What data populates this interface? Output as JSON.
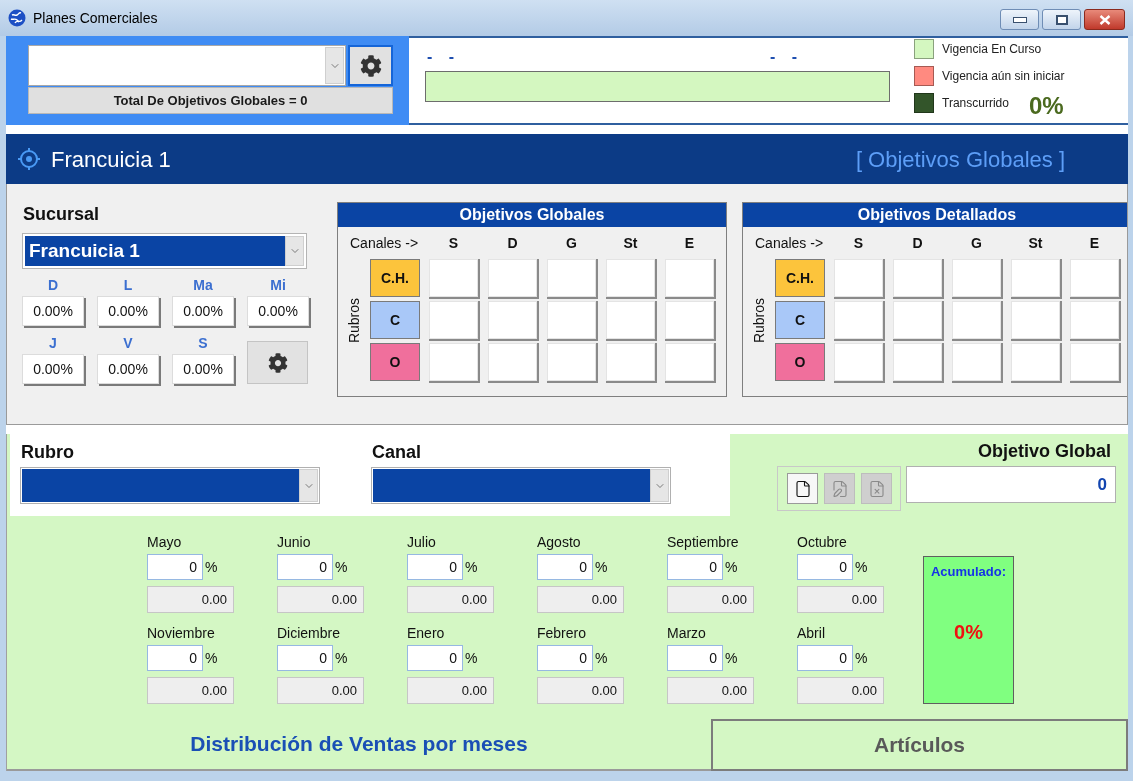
{
  "window": {
    "title": "Planes Comerciales"
  },
  "top_panel": {
    "total_label": "Total De Objetivos Globales = 0"
  },
  "period": {
    "left_text": "- -",
    "right_text": "- -"
  },
  "legend": [
    {
      "label": "Vigencia En Curso",
      "color": "#d4f7c0"
    },
    {
      "label": "Vigencia aún sin iniciar",
      "color": "#ff8a80"
    },
    {
      "label": "Transcurrido",
      "color": "#33552a"
    }
  ],
  "elapsed_percent": "0%",
  "header": {
    "title": "Francuicia 1",
    "section": "[ Objetivos Globales ]"
  },
  "sucursal": {
    "label": "Sucursal",
    "value": "Francuicia 1",
    "days": [
      {
        "label": "D",
        "value": "0.00%"
      },
      {
        "label": "L",
        "value": "0.00%"
      },
      {
        "label": "Ma",
        "value": "0.00%"
      },
      {
        "label": "Mi",
        "value": "0.00%"
      },
      {
        "label": "J",
        "value": "0.00%"
      },
      {
        "label": "V",
        "value": "0.00%"
      },
      {
        "label": "S",
        "value": "0.00%"
      }
    ]
  },
  "matrices": [
    {
      "title": "Objetivos Globales",
      "channels_label": "Canales ->",
      "channels": [
        "S",
        "D",
        "G",
        "St",
        "E"
      ],
      "rows_label": "Rubros",
      "rows": [
        {
          "label": "C.H.",
          "color": "#fcc43c"
        },
        {
          "label": "C",
          "color": "#a9c8f8"
        },
        {
          "label": "O",
          "color": "#f06f9c"
        }
      ]
    },
    {
      "title": "Objetivos Detallados",
      "channels_label": "Canales ->",
      "channels": [
        "S",
        "D",
        "G",
        "St",
        "E"
      ],
      "rows_label": "Rubros",
      "rows": [
        {
          "label": "C.H.",
          "color": "#fcc43c"
        },
        {
          "label": "C",
          "color": "#a9c8f8"
        },
        {
          "label": "O",
          "color": "#f06f9c"
        }
      ]
    }
  ],
  "filters": [
    {
      "label": "Rubro"
    },
    {
      "label": "Canal"
    }
  ],
  "objetivo_global": {
    "label": "Objetivo Global",
    "value": "0",
    "tools": [
      {
        "kind": "new",
        "disabled": false
      },
      {
        "kind": "edit",
        "disabled": true
      },
      {
        "kind": "delete",
        "disabled": true
      }
    ]
  },
  "months": [
    {
      "name": "Mayo",
      "percent": "0",
      "unit": "%",
      "amount": "0.00"
    },
    {
      "name": "Junio",
      "percent": "0",
      "unit": "%",
      "amount": "0.00"
    },
    {
      "name": "Julio",
      "percent": "0",
      "unit": "%",
      "amount": "0.00"
    },
    {
      "name": "Agosto",
      "percent": "0",
      "unit": "%",
      "amount": "0.00"
    },
    {
      "name": "Septiembre",
      "percent": "0",
      "unit": "%",
      "amount": "0.00"
    },
    {
      "name": "Octubre",
      "percent": "0",
      "unit": "%",
      "amount": "0.00"
    },
    {
      "name": "Noviembre",
      "percent": "0",
      "unit": "%",
      "amount": "0.00"
    },
    {
      "name": "Diciembre",
      "percent": "0",
      "unit": "%",
      "amount": "0.00"
    },
    {
      "name": "Enero",
      "percent": "0",
      "unit": "%",
      "amount": "0.00"
    },
    {
      "name": "Febrero",
      "percent": "0",
      "unit": "%",
      "amount": "0.00"
    },
    {
      "name": "Marzo",
      "percent": "0",
      "unit": "%",
      "amount": "0.00"
    },
    {
      "name": "Abril",
      "percent": "0",
      "unit": "%",
      "amount": "0.00"
    }
  ],
  "accumulated": {
    "label": "Acumulado:",
    "value": "0%"
  },
  "tabs": [
    {
      "label": "Distribución de Ventas por meses",
      "selected": true
    },
    {
      "label": "Artículos",
      "selected": false
    }
  ]
}
